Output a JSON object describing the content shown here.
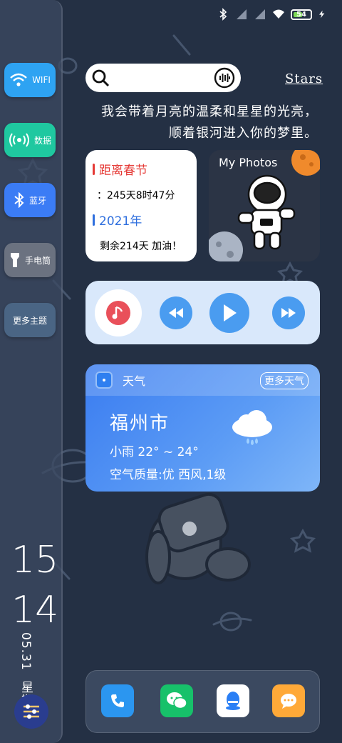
{
  "status_bar": {
    "battery_level": "54",
    "battery_fraction": 0.54,
    "icons": [
      "bluetooth-icon",
      "signal-icon",
      "signal-icon",
      "wifi-icon",
      "battery-icon",
      "charging-icon"
    ]
  },
  "sidebar": {
    "buttons": [
      {
        "label": "WIFI",
        "icon": "wifi-icon",
        "color": "#2ea3f2"
      },
      {
        "label": "数据",
        "icon": "cellular-data-icon",
        "color": "#1fc8a0"
      },
      {
        "label": "蓝牙",
        "icon": "bluetooth-icon",
        "color": "#3b7cf5"
      },
      {
        "label": "手电筒",
        "icon": "flashlight-icon",
        "color": "#6b7280"
      },
      {
        "label": "更多主题",
        "icon": "",
        "color": "#4a6584"
      }
    ],
    "clock": {
      "hour": "15",
      "minute": "14",
      "date": "05.31",
      "weekday": "星期一"
    }
  },
  "search": {
    "icon": "search-icon",
    "voice_icon": "voice-icon"
  },
  "stars_link": "Stars",
  "poem": {
    "line1": "我会带着月亮的温柔和星星的光亮，",
    "line2": "顺着银河进入你的梦里。"
  },
  "countdown": {
    "title": "距离春节",
    "remaining": "：245天8时47分",
    "year": "2021年",
    "year_left": "剩余214天 加油！"
  },
  "photos": {
    "title": "My Photos"
  },
  "music": {
    "icons": [
      "music-note-icon",
      "rewind-icon",
      "play-icon",
      "fast-forward-icon"
    ]
  },
  "weather": {
    "app_name": "天气",
    "more_label": "更多天气",
    "city": "福州市",
    "condition_temp": "小雨  22° ~ 24°",
    "air": "空气质量:优  西风,1级"
  },
  "dock": {
    "apps": [
      "phone-icon",
      "wechat-icon",
      "qq-icon",
      "message-icon"
    ]
  },
  "colors": {
    "background": "#243044",
    "accent_blue": "#4a9cf0",
    "red": "#e53935"
  }
}
